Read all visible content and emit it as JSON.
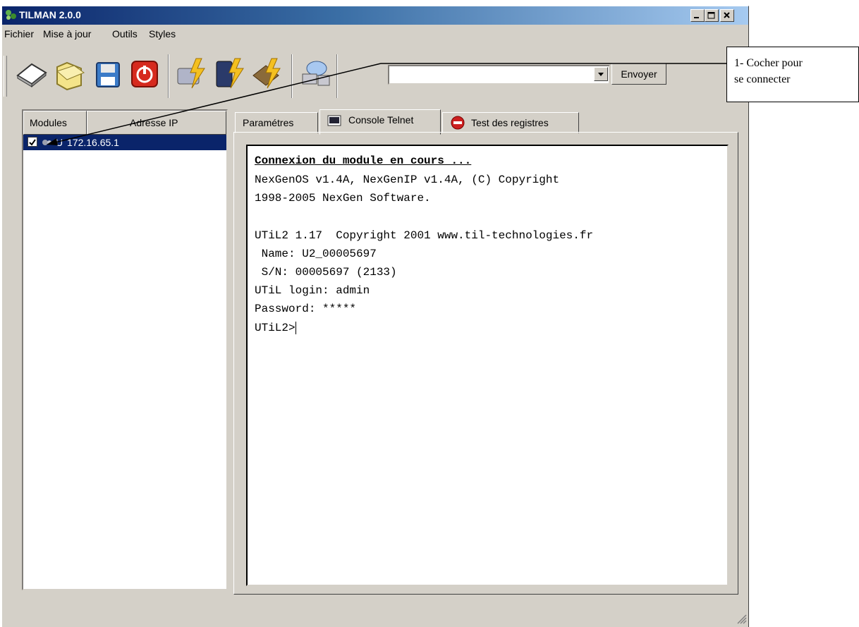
{
  "window": {
    "title": "TILMAN 2.0.0"
  },
  "menu": {
    "file": "Fichier",
    "update": "Mise à jour",
    "tools": "Outils",
    "styles": "Styles"
  },
  "toolbar": {
    "command_value": "",
    "send_label": "Envoyer"
  },
  "modules": {
    "col_modules": "Modules",
    "col_ip": "Adresse IP",
    "rows": [
      {
        "checked": true,
        "name": "U",
        "ip": "172.16.65.1"
      }
    ]
  },
  "tabs": [
    "Paramétres",
    "Console Telnet",
    "Test des registres"
  ],
  "console": {
    "lines": [
      "Connexion du module en cours ...",
      "NexGenOS v1.4A, NexGenIP v1.4A, (C) Copyright",
      "1998-2005 NexGen Software.",
      "",
      "UTiL2 1.17  Copyright 2001 www.til-technologies.fr",
      " Name: U2_00005697",
      " S/N: 00005697 (2133)",
      "UTiL login: admin",
      "Password: *****",
      "UTiL2>"
    ]
  },
  "callout": {
    "line1": "1- Cocher pour",
    "line2": "se connecter"
  },
  "colors": {
    "title_gradient_start": "#0a246a",
    "title_gradient_end": "#a6caf0",
    "selection": "#0a246a",
    "face": "#d4d0c8"
  }
}
